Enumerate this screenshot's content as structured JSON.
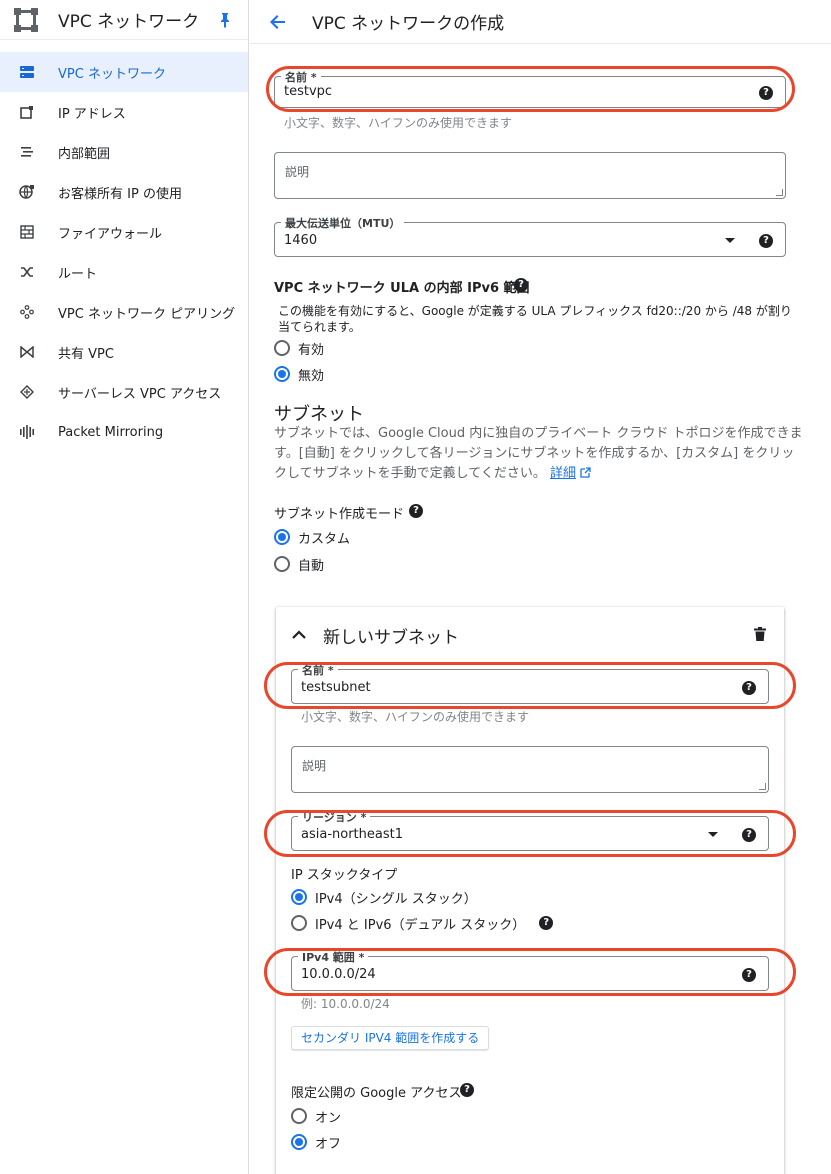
{
  "sidebar": {
    "title": "VPC ネットワーク",
    "items": [
      {
        "label": "VPC ネットワーク",
        "icon": "vpc-network-icon",
        "active": true
      },
      {
        "label": "IP アドレス",
        "icon": "ip-address-icon"
      },
      {
        "label": "内部範囲",
        "icon": "internal-range-icon"
      },
      {
        "label": "お客様所有 IP の使用",
        "icon": "byoip-globe-icon"
      },
      {
        "label": "ファイアウォール",
        "icon": "firewall-icon"
      },
      {
        "label": "ルート",
        "icon": "routes-icon"
      },
      {
        "label": "VPC ネットワーク ピアリング",
        "icon": "peering-icon"
      },
      {
        "label": "共有 VPC",
        "icon": "shared-vpc-icon"
      },
      {
        "label": "サーバーレス VPC アクセス",
        "icon": "serverless-vpc-icon"
      },
      {
        "label": "Packet Mirroring",
        "icon": "packet-mirroring-icon"
      }
    ]
  },
  "header": {
    "title": "VPC ネットワークの作成"
  },
  "form": {
    "name": {
      "label": "名前 *",
      "value": "testvpc",
      "hint": "小文字、数字、ハイフンのみ使用できます"
    },
    "description": {
      "placeholder": "説明"
    },
    "mtu": {
      "label": "最大伝送単位（MTU）",
      "value": "1460"
    },
    "ula": {
      "label": "VPC ネットワーク ULA の内部 IPv6 範囲",
      "description": "この機能を有効にすると、Google が定義する ULA プレフィックス fd20::/20 から /48 が割り当てられます。",
      "options": [
        "有効",
        "無効"
      ],
      "selected": "無効"
    },
    "subnet_section": {
      "title": "サブネット",
      "body": "サブネットでは、Google Cloud 内に独自のプライベート クラウド トポロジを作成できます。[自動] をクリックして各リージョンにサブネットを作成するか、[カスタム] をクリックしてサブネットを手動で定義してください。",
      "link": "詳細"
    },
    "subnet_mode": {
      "label": "サブネット作成モード",
      "options": [
        "カスタム",
        "自動"
      ],
      "selected": "カスタム"
    }
  },
  "new_subnet": {
    "title": "新しいサブネット",
    "name": {
      "label": "名前 *",
      "value": "testsubnet",
      "hint": "小文字、数字、ハイフンのみ使用できます"
    },
    "description": {
      "placeholder": "説明"
    },
    "region": {
      "label": "リージョン *",
      "value": "asia-northeast1"
    },
    "ip_stack": {
      "label": "IP スタックタイプ",
      "options": [
        "IPv4（シングル スタック）",
        "IPv4 と IPv6（デュアル スタック）"
      ],
      "selected": "IPv4（シングル スタック）"
    },
    "ipv4_range": {
      "label": "IPv4 範囲 *",
      "value": "10.0.0.0/24",
      "hint": "例: 10.0.0.0/24"
    },
    "secondary_button": "セカンダリ IPV4 範囲を作成する",
    "private_google_access": {
      "label": "限定公開の Google アクセス",
      "options": [
        "オン",
        "オフ"
      ],
      "selected": "オフ"
    }
  },
  "colors": {
    "accent": "#1a73e8",
    "active_bg": "#e8f0fe",
    "highlight": "#e8472b"
  }
}
